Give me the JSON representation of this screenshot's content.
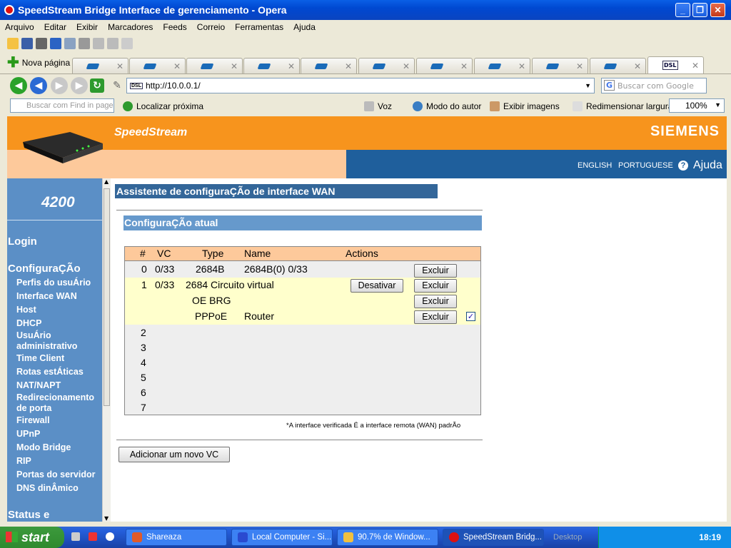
{
  "window": {
    "title": "SpeedStream Bridge Interface de gerenciamento - Opera"
  },
  "menu": [
    "Arquivo",
    "Editar",
    "Exibir",
    "Marcadores",
    "Feeds",
    "Correio",
    "Ferramentas",
    "Ajuda"
  ],
  "tabs": {
    "new_page_label": "Nova página"
  },
  "address": {
    "url": "http://10.0.0.1/",
    "favicon_text": "DSL",
    "search_placeholder": "Buscar com Google"
  },
  "findbar": {
    "find_placeholder": "Buscar com Find in page",
    "find_next": "Localizar próxima",
    "voice": "Voz",
    "author_mode": "Modo do autor",
    "show_images": "Exibir imagens",
    "fit_width": "Redimensionar largura",
    "zoom": "100%"
  },
  "header": {
    "brand": "SpeedStream",
    "vendor": "SIEMENS",
    "lang_english": "ENGLISH",
    "lang_portuguese": "PORTUGUESE",
    "help": "Ajuda",
    "model": "4200"
  },
  "sidebar": {
    "login": "Login",
    "config": "ConfiguraÇÃo",
    "items": [
      "Perfis do usuÁrio",
      "Interface WAN",
      "Host",
      "DHCP",
      "UsuÁrio administrativo",
      "Time Client",
      "Rotas estÁticas",
      "NAT/NAPT",
      "Redirecionamento de porta",
      "Firewall",
      "UPnP",
      "Modo Bridge",
      "RIP",
      "Portas do servidor",
      "DNS dinÂmico"
    ],
    "status": "Status e"
  },
  "main": {
    "title": "Assistente de configuraÇÃo de interface WAN",
    "current_config": "ConfiguraÇÃo atual",
    "columns": [
      "#",
      "VC",
      "Type",
      "Name",
      "Actions"
    ],
    "rows": [
      {
        "num": "0",
        "vc": "0/33",
        "type": "2684B",
        "name": "2684B(0) 0/33",
        "delete": "Excluir"
      },
      {
        "num": "1",
        "vc": "0/33",
        "type": "2684 Circuito virtual",
        "deactivate": "Desativar",
        "delete": "Excluir"
      },
      {
        "type": "OE BRG",
        "delete": "Excluir"
      },
      {
        "type": "PPPoE",
        "name": "Router",
        "delete": "Excluir",
        "checked": "✓"
      },
      {
        "num": "2"
      },
      {
        "num": "3"
      },
      {
        "num": "4"
      },
      {
        "num": "5"
      },
      {
        "num": "6"
      },
      {
        "num": "7"
      }
    ],
    "note": "*A interface verificada É a interface remota (WAN) padrÃo",
    "add_vc": "Adicionar um novo VC"
  },
  "taskbar": {
    "start": "start",
    "tasks": [
      "Shareaza",
      "Local Computer - Si...",
      "90.7% de Window...",
      "SpeedStream Bridg..."
    ],
    "clock": "18:19",
    "desktop": "Desktop"
  }
}
